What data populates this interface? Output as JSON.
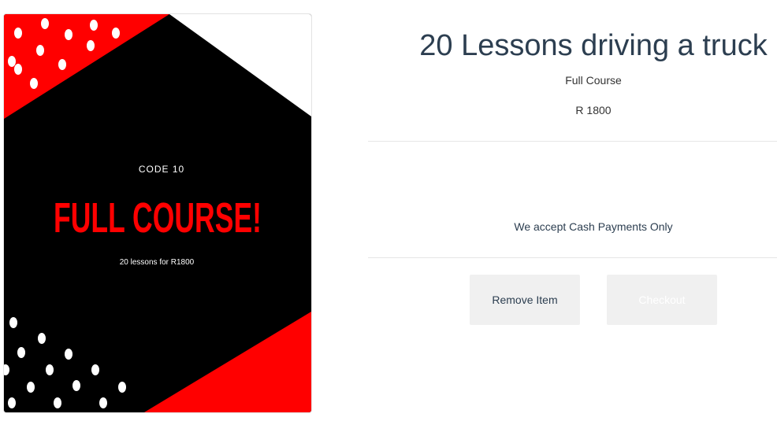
{
  "product": {
    "image": {
      "code_label": "CODE 10",
      "headline": "FULL COURSE!",
      "tagline": "20 lessons for R1800",
      "colors": {
        "background": "#000000",
        "accent": "#ff0000",
        "dots": "#ffffff"
      }
    },
    "title": "20 Lessons driving a truck",
    "subtitle": "Full Course",
    "price": "R 1800",
    "payment_note": "We accept Cash Payments Only"
  },
  "actions": {
    "remove_label": "Remove Item",
    "checkout_label": "Checkout"
  },
  "colors": {
    "title_text": "#2c3e50",
    "button_bg": "#f0f0f0"
  }
}
